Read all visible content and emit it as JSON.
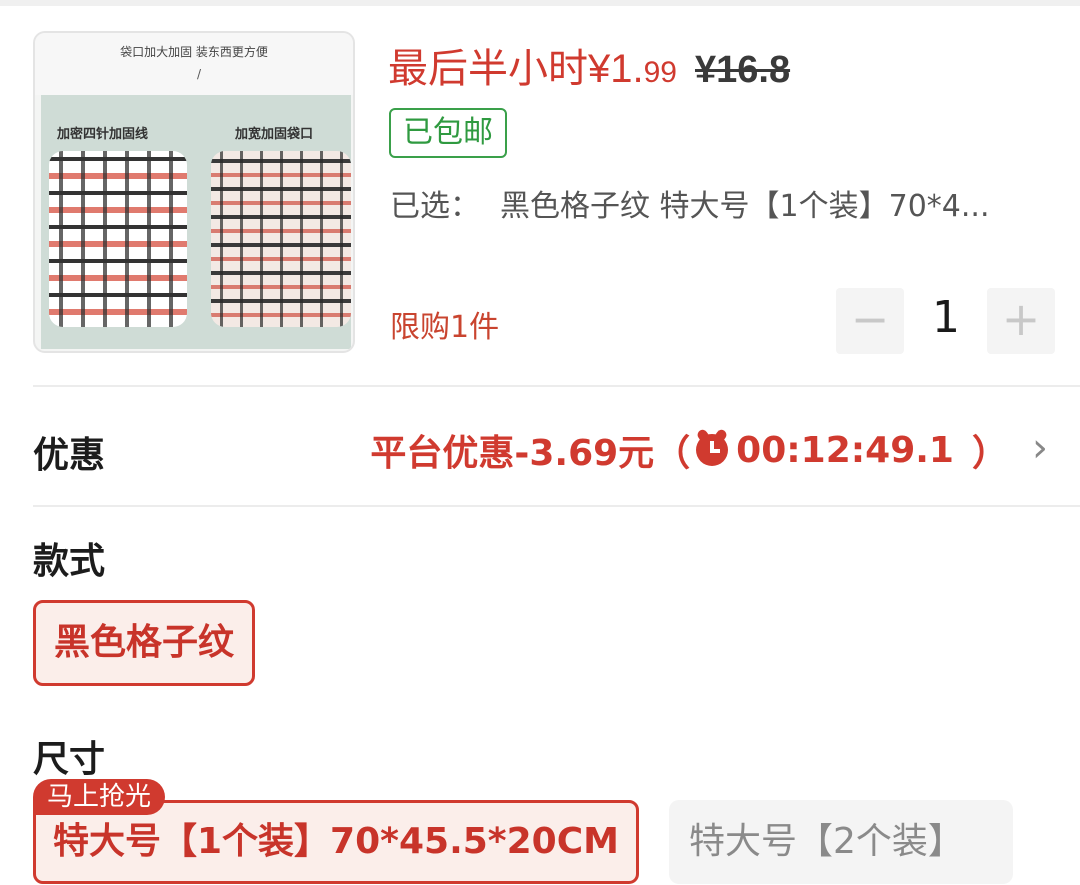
{
  "product": {
    "image": {
      "caption_top": "袋口加大加固 装东西更方便",
      "slash": "/",
      "label_left": "加密四针加固线",
      "label_right": "加宽加固袋口"
    },
    "price": {
      "prefix": "最后半小时",
      "currency": "¥",
      "integer": "1.",
      "decimal": "99",
      "original": "¥16.8"
    },
    "free_shipping": "已包邮",
    "selected_label": "已选：",
    "selected_value": "黑色格子纹 特大号【1个装】70*4...",
    "limit": "限购1件",
    "quantity": {
      "minus_icon": "minus-icon",
      "value": "1",
      "plus_icon": "plus-icon"
    }
  },
  "discount": {
    "heading": "优惠",
    "text": "平台优惠-3.69元（",
    "icon": "alarm-clock-icon",
    "countdown": "00:12:49.1",
    "close_paren": "）",
    "chevron": "chevron-right-icon"
  },
  "style_section": {
    "heading": "款式",
    "options": [
      "黑色格子纹"
    ]
  },
  "size_section": {
    "heading": "尺寸",
    "badge": "马上抢光",
    "options": [
      "特大号【1个装】70*45.5*20CM",
      "特大号【2个装】"
    ]
  },
  "colors": {
    "accent_red": "#d03a2f",
    "shipping_green": "#2f9a40"
  }
}
